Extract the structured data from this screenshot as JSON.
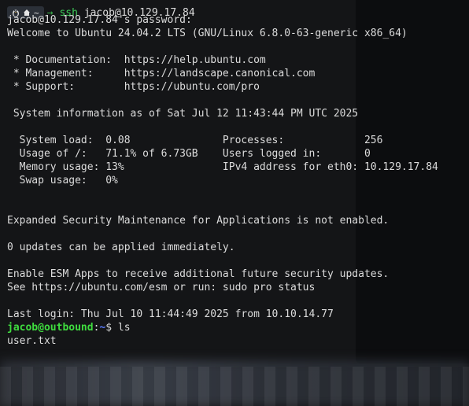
{
  "prompt_bar": {
    "path": "~",
    "command": "ssh",
    "args": "jacob@10.129.17.84"
  },
  "lines": [
    "jacob@10.129.17.84's password:",
    "Welcome to Ubuntu 24.04.2 LTS (GNU/Linux 6.8.0-63-generic x86_64)",
    "",
    " * Documentation:  https://help.ubuntu.com",
    " * Management:     https://landscape.canonical.com",
    " * Support:        https://ubuntu.com/pro",
    "",
    " System information as of Sat Jul 12 11:43:44 PM UTC 2025",
    "",
    "  System load:  0.08               Processes:             256",
    "  Usage of /:   71.1% of 6.73GB    Users logged in:       0",
    "  Memory usage: 13%                IPv4 address for eth0: 10.129.17.84",
    "  Swap usage:   0%",
    "",
    "",
    "Expanded Security Maintenance for Applications is not enabled.",
    "",
    "0 updates can be applied immediately.",
    "",
    "Enable ESM Apps to receive additional future security updates.",
    "See https://ubuntu.com/esm or run: sudo pro status",
    "",
    "Last login: Thu Jul 10 11:44:49 2025 from 10.10.14.77"
  ],
  "remote_prompt": {
    "user_host": "jacob@outbound",
    "separator": ":",
    "cwd": "~",
    "symbol": "$ ",
    "command": "ls"
  },
  "output": [
    "user.txt"
  ],
  "colors": {
    "background": "#141517",
    "text": "#dcdcdc",
    "user_host": "#3fdc3f",
    "cwd": "#5b7cff",
    "ssh_command": "#3ecf5a"
  },
  "icons": [
    "linux-icon",
    "home-icon"
  ]
}
